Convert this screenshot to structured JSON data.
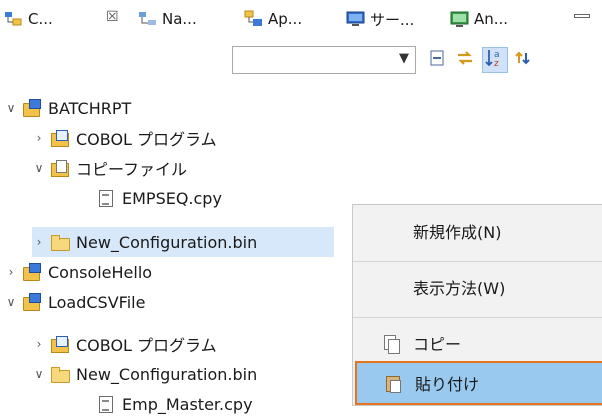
{
  "tabs": [
    {
      "label": "C..."
    },
    {
      "label": "Na..."
    },
    {
      "label": "Ap..."
    },
    {
      "label": "サー..."
    },
    {
      "label": "An..."
    }
  ],
  "toolbar": {
    "combo_value": ""
  },
  "tree": {
    "rows": [
      {
        "label": "BATCHRPT"
      },
      {
        "label": "COBOL プログラム"
      },
      {
        "label": "コピーファイル"
      },
      {
        "label": "EMPSEQ.cpy"
      },
      {
        "label": "New_Configuration.bin"
      },
      {
        "label": "ConsoleHello"
      },
      {
        "label": "LoadCSVFile"
      },
      {
        "label": "COBOL プログラム"
      },
      {
        "label": "New_Configuration.bin"
      },
      {
        "label": "Emp_Master.cpy"
      }
    ]
  },
  "context_menu": {
    "items": [
      {
        "label": "新規作成(N)"
      },
      {
        "label": "表示方法(W)"
      },
      {
        "label": "コピー"
      },
      {
        "label": "貼り付け"
      }
    ]
  }
}
